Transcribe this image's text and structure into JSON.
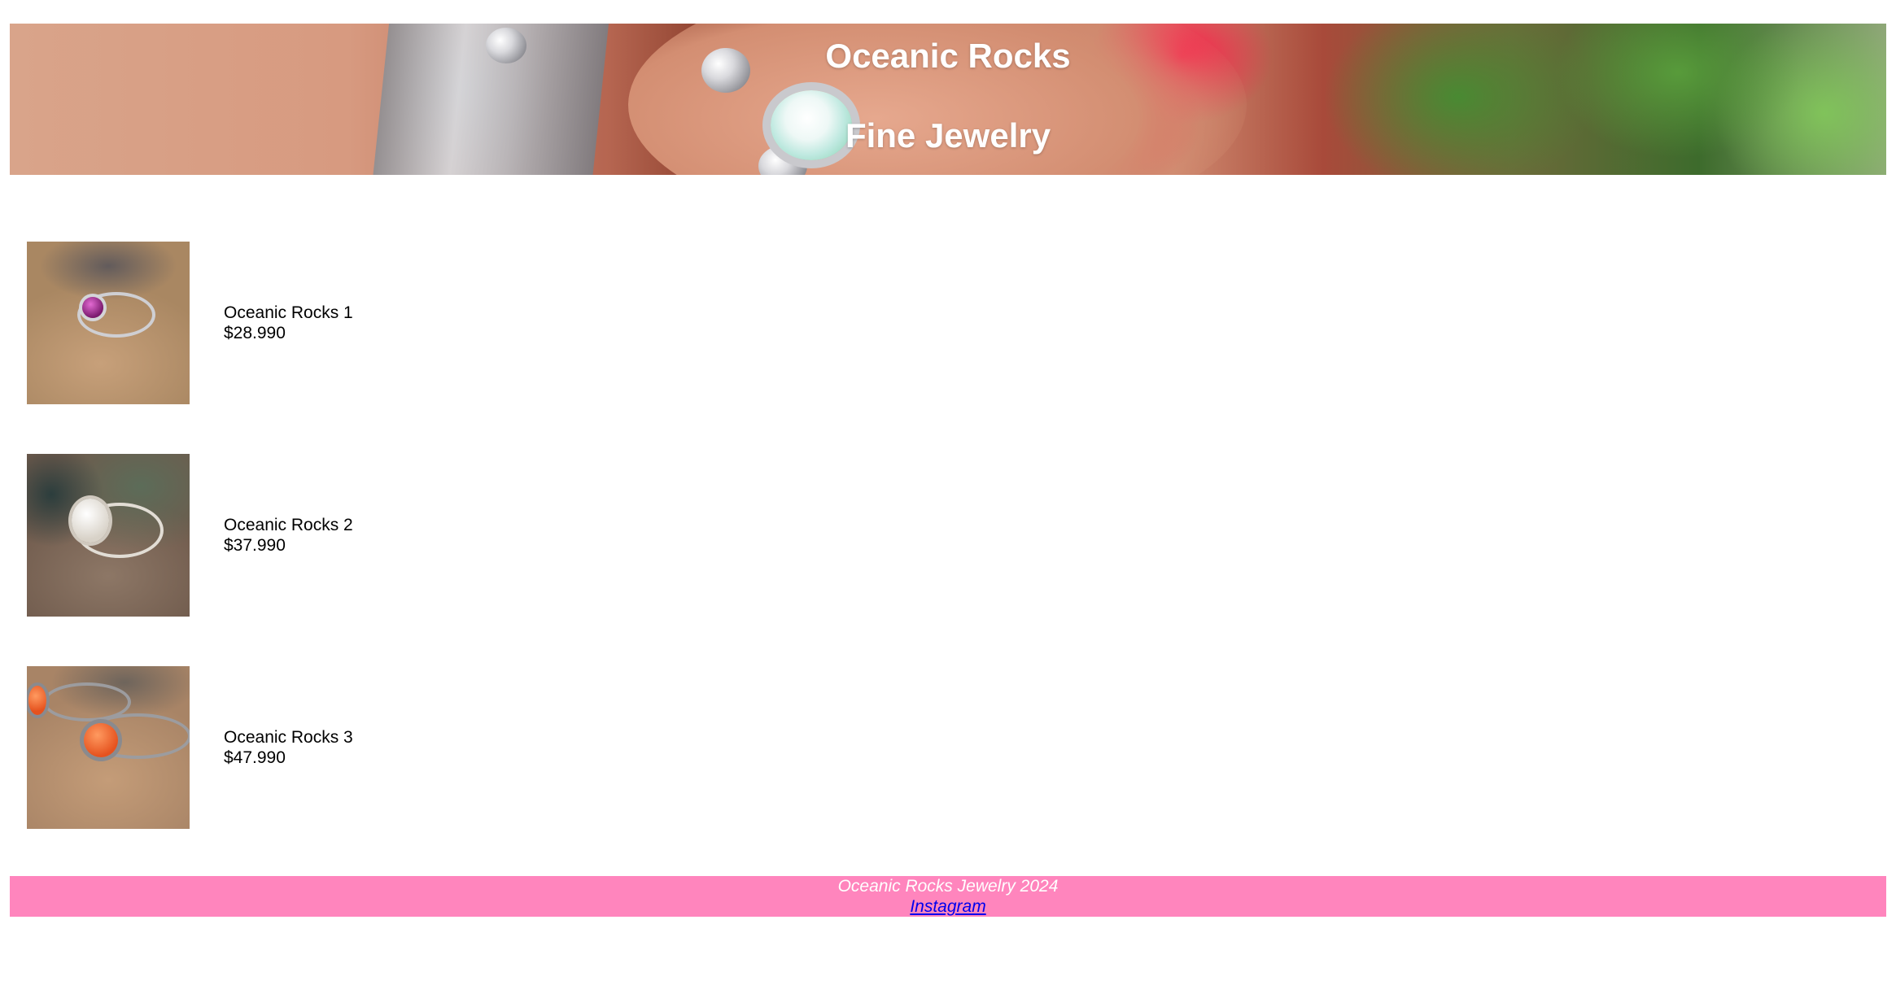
{
  "header": {
    "title_line1": "Oceanic Rocks",
    "title_line2": "Fine Jewelry"
  },
  "products": [
    {
      "name": "Oceanic Rocks 1",
      "price": "$28.990",
      "stone_color": "#7a1a6e"
    },
    {
      "name": "Oceanic Rocks 2",
      "price": "$37.990",
      "stone_color": "#d8d2c8"
    },
    {
      "name": "Oceanic Rocks 3",
      "price": "$47.990",
      "stone_color": "#e5521e"
    }
  ],
  "footer": {
    "copyright": "Oceanic Rocks Jewelry 2024",
    "instagram_label": "Instagram",
    "background": "#ff85bd",
    "link_color": "#0000ee"
  }
}
